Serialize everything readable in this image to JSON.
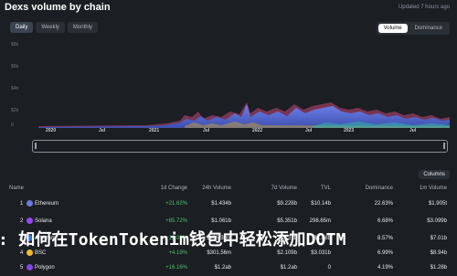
{
  "header": {
    "title": "Dexs volume by chain",
    "updated": "Updated 7 hours ago"
  },
  "periods": [
    "Daily",
    "Weekly",
    "Monthly"
  ],
  "metrics": [
    "Volume",
    "Dominance"
  ],
  "chart_data": {
    "type": "area",
    "x_ticks": [
      "2020",
      "Jul",
      "2021",
      "Jul",
      "2022",
      "Jul",
      "2023",
      "Jul"
    ],
    "y_ticks": [
      "$8b",
      "$6b",
      "$4b",
      "$2b",
      "0"
    ]
  },
  "table": {
    "columns_button": "Columns",
    "headers": [
      "Name",
      "1d Change",
      "24h Volume",
      "7d Volume",
      "TVL",
      "Dominance",
      "1m Volume"
    ],
    "rows": [
      {
        "rank": "1",
        "name": "Ethereum",
        "change": "+21.62%",
        "vol24": "$1.434b",
        "vol7d": "$9.228b",
        "tvl": "$10.14b",
        "dom": "22.63%",
        "vol1m": "$1.905t",
        "color": "#6c7ae0",
        "neg": false
      },
      {
        "rank": "2",
        "name": "Solana",
        "change": "+85.72%",
        "vol24": "$1.061b",
        "vol7d": "$5.351b",
        "tvl": "298.65m",
        "dom": "6.68%",
        "vol1m": "$3.099b",
        "color": "#9945ff",
        "neg": false
      },
      {
        "rank": "3",
        "name": "Arbitrum",
        "change": "+12.06%",
        "vol24": "$405.39m",
        "vol7d": "$2.31b",
        "tvl": "$1.88b",
        "dom": "8.57%",
        "vol1m": "$7.01b",
        "color": "#2d74da",
        "neg": false
      },
      {
        "rank": "4",
        "name": "BSC",
        "change": "+4.19%",
        "vol24": "$301.56m",
        "vol7d": "$2.109b",
        "tvl": "$3.031b",
        "dom": "6.99%",
        "vol1m": "$8.94b",
        "color": "#f3ba2f",
        "neg": false
      },
      {
        "rank": "5",
        "name": "Polygon",
        "change": "+16.16%",
        "vol24": "$1.2ab",
        "vol7d": "$1.2ab",
        "tvl": "0",
        "dom": "4.19%",
        "vol1m": "$1.28b",
        "color": "#8247e5",
        "neg": false
      }
    ]
  },
  "overlay": {
    "text": ": 如何在TokenTokenim钱包中轻松添加DOTM"
  }
}
